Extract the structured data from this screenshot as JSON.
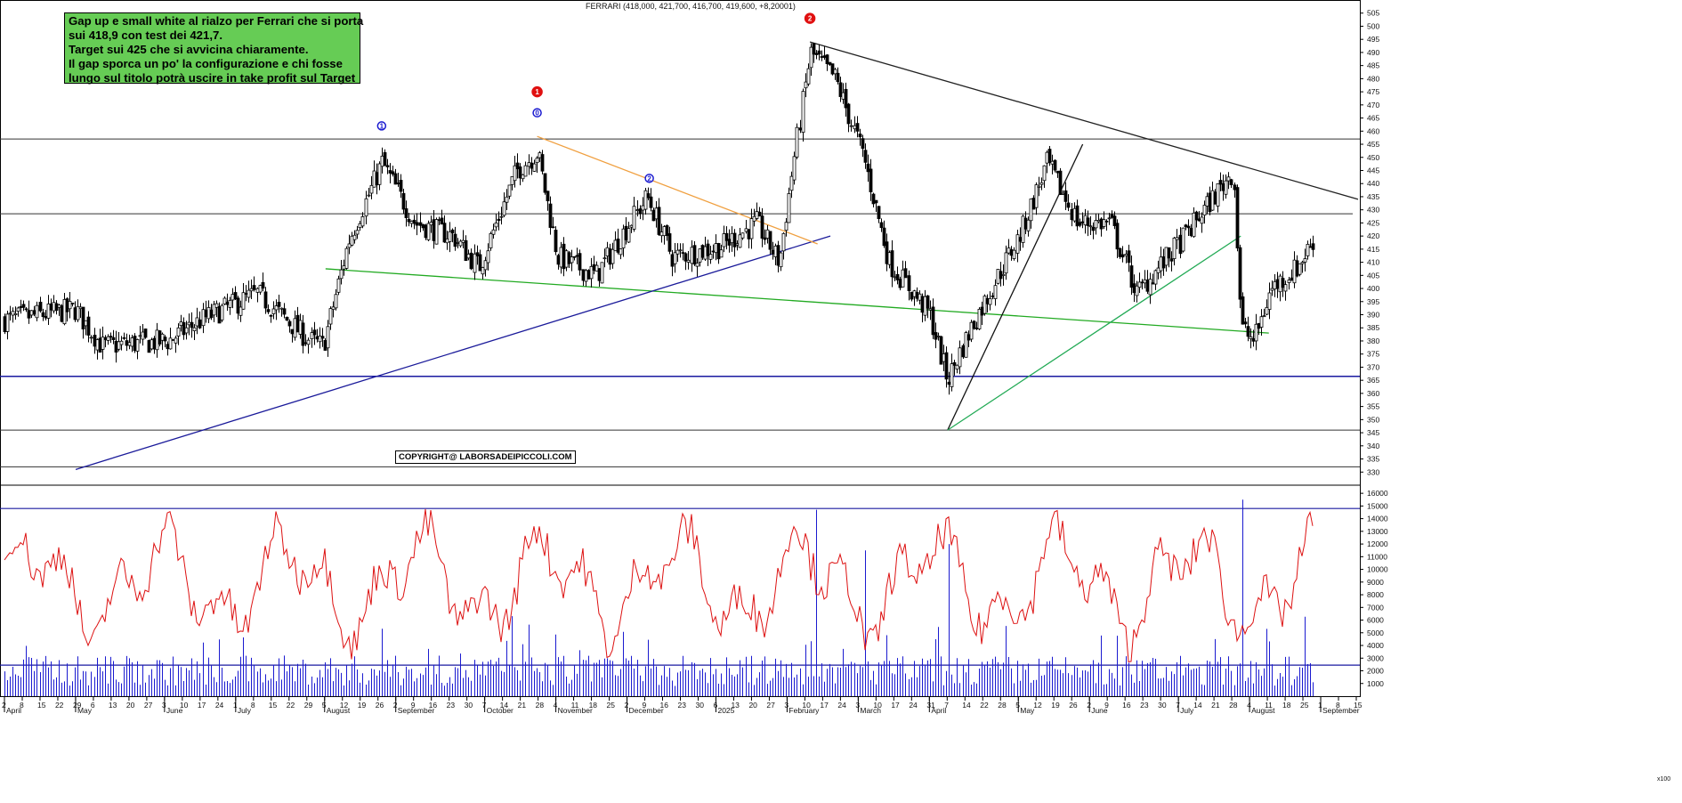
{
  "chart_data": {
    "type": "candlestick",
    "title": "FERRARI (418,000, 421,700, 416,700, 419,600, +8,20001)",
    "note": {
      "lines": [
        "Gap up e small white al rialzo per Ferrari che si porta",
        "sui 418,9 con test dei 421,7.",
        "Target sui 425 che si avvicina chiaramente.",
        "Il gap sporca un po' la configurazione e chi fosse",
        "lungo sul titolo potrà uscire in take profit sul Target"
      ]
    },
    "copyright": "COPYRIGHT@ LABORSADEIPICCOLI.COM",
    "price_axis": {
      "range": [
        325,
        510
      ],
      "ticks": [
        330,
        335,
        340,
        345,
        350,
        355,
        360,
        365,
        370,
        375,
        380,
        385,
        390,
        395,
        400,
        405,
        410,
        415,
        420,
        425,
        430,
        435,
        440,
        445,
        450,
        455,
        460,
        465,
        470,
        475,
        480,
        485,
        490,
        495,
        500,
        505
      ]
    },
    "volume_axis": {
      "range": [
        0,
        16500
      ],
      "ticks": [
        1000,
        2000,
        3000,
        4000,
        5000,
        6000,
        7000,
        8000,
        9000,
        10000,
        11000,
        12000,
        13000,
        14000,
        15000,
        16000
      ],
      "unit_label": "x100"
    },
    "x_axis": {
      "day_ticks": [
        "2",
        "8",
        "15",
        "22",
        "29",
        "6",
        "13",
        "20",
        "27",
        "3",
        "10",
        "17",
        "24",
        "1",
        "8",
        "15",
        "22",
        "29",
        "5",
        "12",
        "19",
        "26",
        "2",
        "9",
        "16",
        "23",
        "30",
        "7",
        "14",
        "21",
        "28",
        "4",
        "11",
        "18",
        "25",
        "2",
        "9",
        "16",
        "23",
        "30",
        "6",
        "13",
        "20",
        "27",
        "3",
        "10",
        "17",
        "24",
        "3",
        "10",
        "17",
        "24",
        "31",
        "7",
        "14",
        "22",
        "28",
        "5",
        "12",
        "19",
        "26",
        "2",
        "9",
        "16",
        "23",
        "30",
        "7",
        "14",
        "21",
        "28",
        "4",
        "11",
        "18",
        "25",
        "1",
        "8",
        "15"
      ],
      "months": [
        "April",
        "May",
        "June",
        "July",
        "August",
        "September",
        "October",
        "November",
        "December",
        "2025",
        "February",
        "March",
        "April",
        "May",
        "June",
        "July",
        "August",
        "September"
      ]
    },
    "horizontal_levels": [
      {
        "value": 457,
        "color": "#333333"
      },
      {
        "value": 428.5,
        "color": "#333333"
      },
      {
        "value": 366.5,
        "color": "#1a1aa0"
      },
      {
        "value": 346,
        "color": "#333333"
      },
      {
        "value": 332,
        "color": "#333333"
      }
    ],
    "volume_levels": [
      {
        "value": 14800,
        "color": "#1a1aa0"
      },
      {
        "value": 2450,
        "color": "#1a1aa0"
      }
    ],
    "trendlines": [
      {
        "name": "green support",
        "color": "#22aa22",
        "from": [
          "2024-08-06",
          407.5
        ],
        "to": [
          "2025-08-11",
          383
        ]
      },
      {
        "name": "long uptrend",
        "color": "#1a1a9a",
        "from": [
          "2024-04-30",
          331
        ],
        "to": [
          "2025-02-20",
          420
        ]
      },
      {
        "name": "orange downtrend",
        "color": "#f0a040",
        "from": [
          "2024-10-28",
          458
        ],
        "to": [
          "2025-02-15",
          417
        ]
      },
      {
        "name": "major downtrend",
        "color": "#222222",
        "from": [
          "2025-02-12",
          494
        ],
        "to": [
          "2025-09-15",
          434
        ]
      },
      {
        "name": "steep uptrend",
        "color": "#111111",
        "from": [
          "2025-04-07",
          346
        ],
        "to": [
          "2025-05-30",
          455
        ]
      },
      {
        "name": "green uptrend",
        "color": "#22aa55",
        "from": [
          "2025-04-07",
          346
        ],
        "to": [
          "2025-07-31",
          420
        ]
      }
    ],
    "markers": [
      {
        "label": "1",
        "style": "blue",
        "date": "2024-08-28",
        "price": 462
      },
      {
        "label": "0",
        "style": "blue",
        "date": "2024-10-28",
        "price": 467
      },
      {
        "label": "1",
        "style": "red",
        "date": "2024-10-28",
        "price": 475
      },
      {
        "label": "2",
        "style": "blue",
        "date": "2024-12-11",
        "price": 442
      },
      {
        "label": "2",
        "style": "red",
        "date": "2025-02-12",
        "price": 503
      }
    ],
    "key_points": [
      {
        "date": "2024-04-02",
        "close": 388
      },
      {
        "date": "2024-04-30",
        "close": 392
      },
      {
        "date": "2024-05-10",
        "close": 378
      },
      {
        "date": "2024-06-05",
        "close": 380
      },
      {
        "date": "2024-06-20",
        "close": 389
      },
      {
        "date": "2024-07-10",
        "close": 398
      },
      {
        "date": "2024-07-31",
        "close": 380
      },
      {
        "date": "2024-08-05",
        "close": 378
      },
      {
        "date": "2024-08-15",
        "close": 418
      },
      {
        "date": "2024-08-28",
        "close": 448
      },
      {
        "date": "2024-09-10",
        "close": 425
      },
      {
        "date": "2024-09-25",
        "close": 420
      },
      {
        "date": "2024-10-05",
        "close": 408
      },
      {
        "date": "2024-10-20",
        "close": 445
      },
      {
        "date": "2024-10-28",
        "close": 452
      },
      {
        "date": "2024-11-05",
        "close": 412
      },
      {
        "date": "2024-11-20",
        "close": 405
      },
      {
        "date": "2024-12-10",
        "close": 435
      },
      {
        "date": "2024-12-20",
        "close": 412
      },
      {
        "date": "2025-01-08",
        "close": 416
      },
      {
        "date": "2025-01-22",
        "close": 425
      },
      {
        "date": "2025-01-31",
        "close": 410
      },
      {
        "date": "2025-02-05",
        "close": 445
      },
      {
        "date": "2025-02-12",
        "close": 490
      },
      {
        "date": "2025-02-22",
        "close": 480
      },
      {
        "date": "2025-03-05",
        "close": 450
      },
      {
        "date": "2025-03-15",
        "close": 410
      },
      {
        "date": "2025-03-31",
        "close": 390
      },
      {
        "date": "2025-04-07",
        "close": 365
      },
      {
        "date": "2025-04-16",
        "close": 385
      },
      {
        "date": "2025-05-05",
        "close": 420
      },
      {
        "date": "2025-05-16",
        "close": 448
      },
      {
        "date": "2025-05-28",
        "close": 425
      },
      {
        "date": "2025-06-10",
        "close": 425
      },
      {
        "date": "2025-06-20",
        "close": 398
      },
      {
        "date": "2025-07-05",
        "close": 415
      },
      {
        "date": "2025-07-28",
        "close": 445
      },
      {
        "date": "2025-07-31",
        "close": 385
      },
      {
        "date": "2025-08-05",
        "close": 380
      },
      {
        "date": "2025-08-12",
        "close": 400
      },
      {
        "date": "2025-08-22",
        "close": 408
      },
      {
        "date": "2025-08-29",
        "close": 419.6
      }
    ],
    "volume_line": {
      "color": "#dd1111",
      "approx_range": [
        2000,
        15800
      ]
    },
    "volume_bars": {
      "color": "#1a1ad0",
      "spikes": [
        {
          "date": "2025-02-14",
          "value": 14700
        },
        {
          "date": "2025-03-05",
          "value": 11500
        },
        {
          "date": "2025-04-07",
          "value": 12000
        },
        {
          "date": "2025-07-31",
          "value": 15500
        }
      ]
    }
  }
}
